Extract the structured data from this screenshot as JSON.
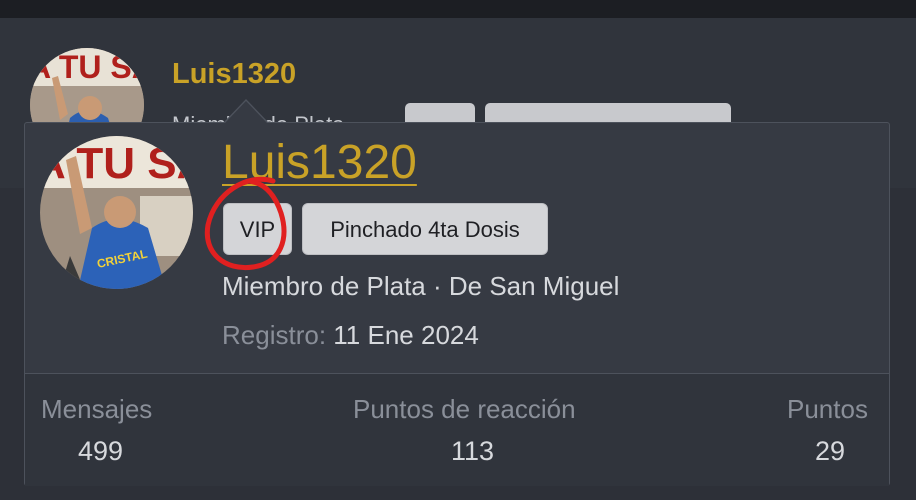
{
  "background_post": {
    "username": "Luis1320",
    "partial_text": "Miembro de Plata"
  },
  "tooltip": {
    "username": "Luis1320",
    "badges": [
      {
        "label": "VIP"
      },
      {
        "label": "Pinchado 4ta Dosis"
      }
    ],
    "member_line": "Miembro de Plata · De San Miguel",
    "registration_label": "Registro:",
    "registration_value": "11 Ene 2024",
    "stats": [
      {
        "label": "Mensajes",
        "value": "499"
      },
      {
        "label": "Puntos de reacción",
        "value": "113"
      },
      {
        "label": "Puntos",
        "value": "29"
      }
    ]
  },
  "colors": {
    "username": "#c9a227",
    "badge_bg": "#d4d5d8",
    "annotation": "#e02020"
  }
}
